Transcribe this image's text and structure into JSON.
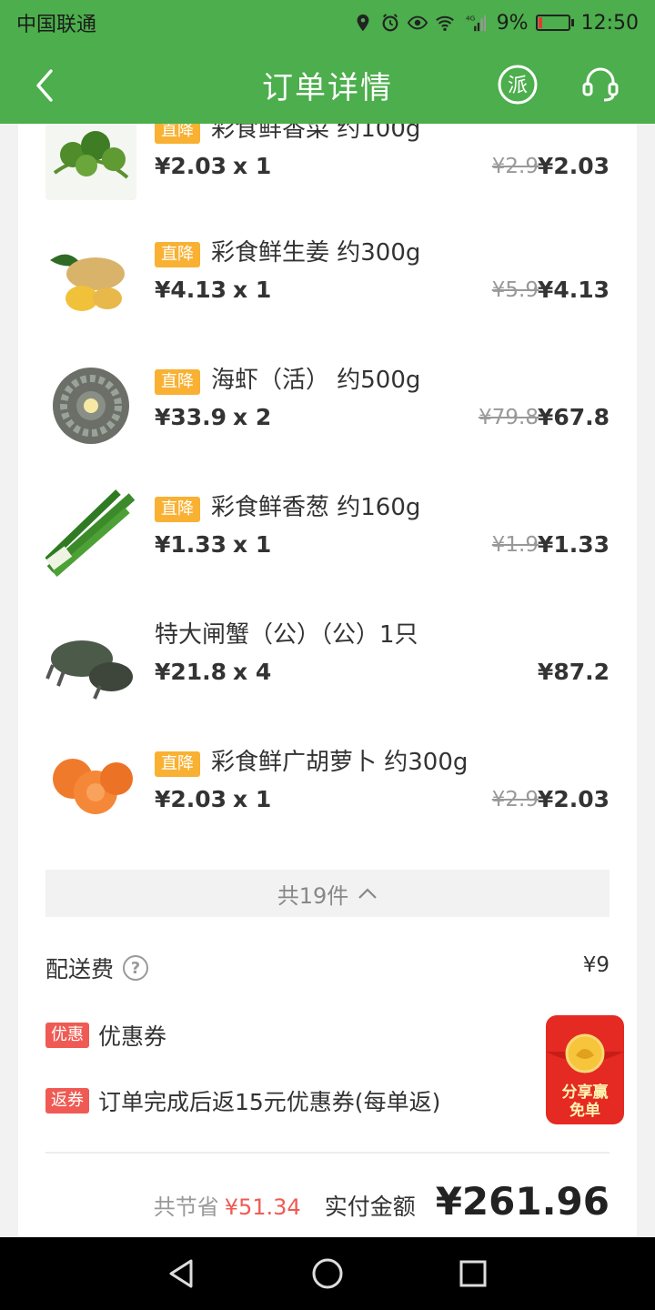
{
  "status_bar": {
    "carrier": "中国联通",
    "battery": "9%",
    "time": "12:50",
    "network": "4G"
  },
  "header": {
    "title": "订单详情"
  },
  "items": [
    {
      "tag": "直降",
      "name": "彩食鲜香菜 约100g",
      "unit_price": "¥2.03",
      "qty": "x  1",
      "orig_price": "¥2.9",
      "total": "¥2.03"
    },
    {
      "tag": "直降",
      "name": "彩食鲜生姜 约300g",
      "unit_price": "¥4.13",
      "qty": "x  1",
      "orig_price": "¥5.9",
      "total": "¥4.13"
    },
    {
      "tag": "直降",
      "name": "海虾（活） 约500g",
      "unit_price": "¥33.9",
      "qty": "x  2",
      "orig_price": "¥79.8",
      "total": "¥67.8"
    },
    {
      "tag": "直降",
      "name": "彩食鲜香葱 约160g",
      "unit_price": "¥1.33",
      "qty": "x  1",
      "orig_price": "¥1.9",
      "total": "¥1.33"
    },
    {
      "tag": "",
      "name": "特大闸蟹（公）（公）1只",
      "unit_price": "¥21.8",
      "qty": "x  4",
      "orig_price": "",
      "total": "¥87.2"
    },
    {
      "tag": "直降",
      "name": "彩食鲜广胡萝卜 约300g",
      "unit_price": "¥2.03",
      "qty": "x  1",
      "orig_price": "¥2.9",
      "total": "¥2.03"
    }
  ],
  "collapse": {
    "label": "共19件"
  },
  "delivery": {
    "label": "配送费",
    "value": "¥9"
  },
  "coupon": {
    "badge": "优惠",
    "label": "优惠券"
  },
  "return_coupon": {
    "badge": "返券",
    "label": "订单完成后返15元优惠券(每单返)"
  },
  "red_packet": {
    "line1": "分享赢",
    "line2": "免单"
  },
  "summary": {
    "save_label": "共节省",
    "save_value": "¥51.34",
    "paid_label": "实付金额",
    "paid_value": "¥261.96"
  },
  "colors": {
    "brand_green": "#4cae4c",
    "tag_orange": "#f8b133",
    "badge_red": "#ef5b54"
  }
}
